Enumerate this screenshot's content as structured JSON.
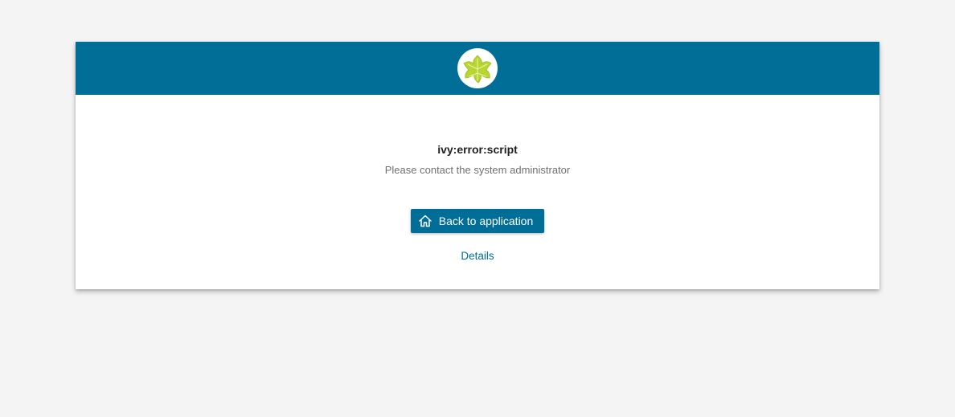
{
  "header": {
    "logo_icon": "ivy-leaf-icon",
    "background_color": "#006e96"
  },
  "error": {
    "title": "ivy:error:script",
    "message": "Please contact the system administrator"
  },
  "actions": {
    "back_button_label": "Back to application",
    "back_button_icon": "home-icon",
    "details_link_label": "Details"
  },
  "colors": {
    "accent": "#006e96",
    "leaf": "#b9d532",
    "page_background": "#f4f4f4"
  }
}
